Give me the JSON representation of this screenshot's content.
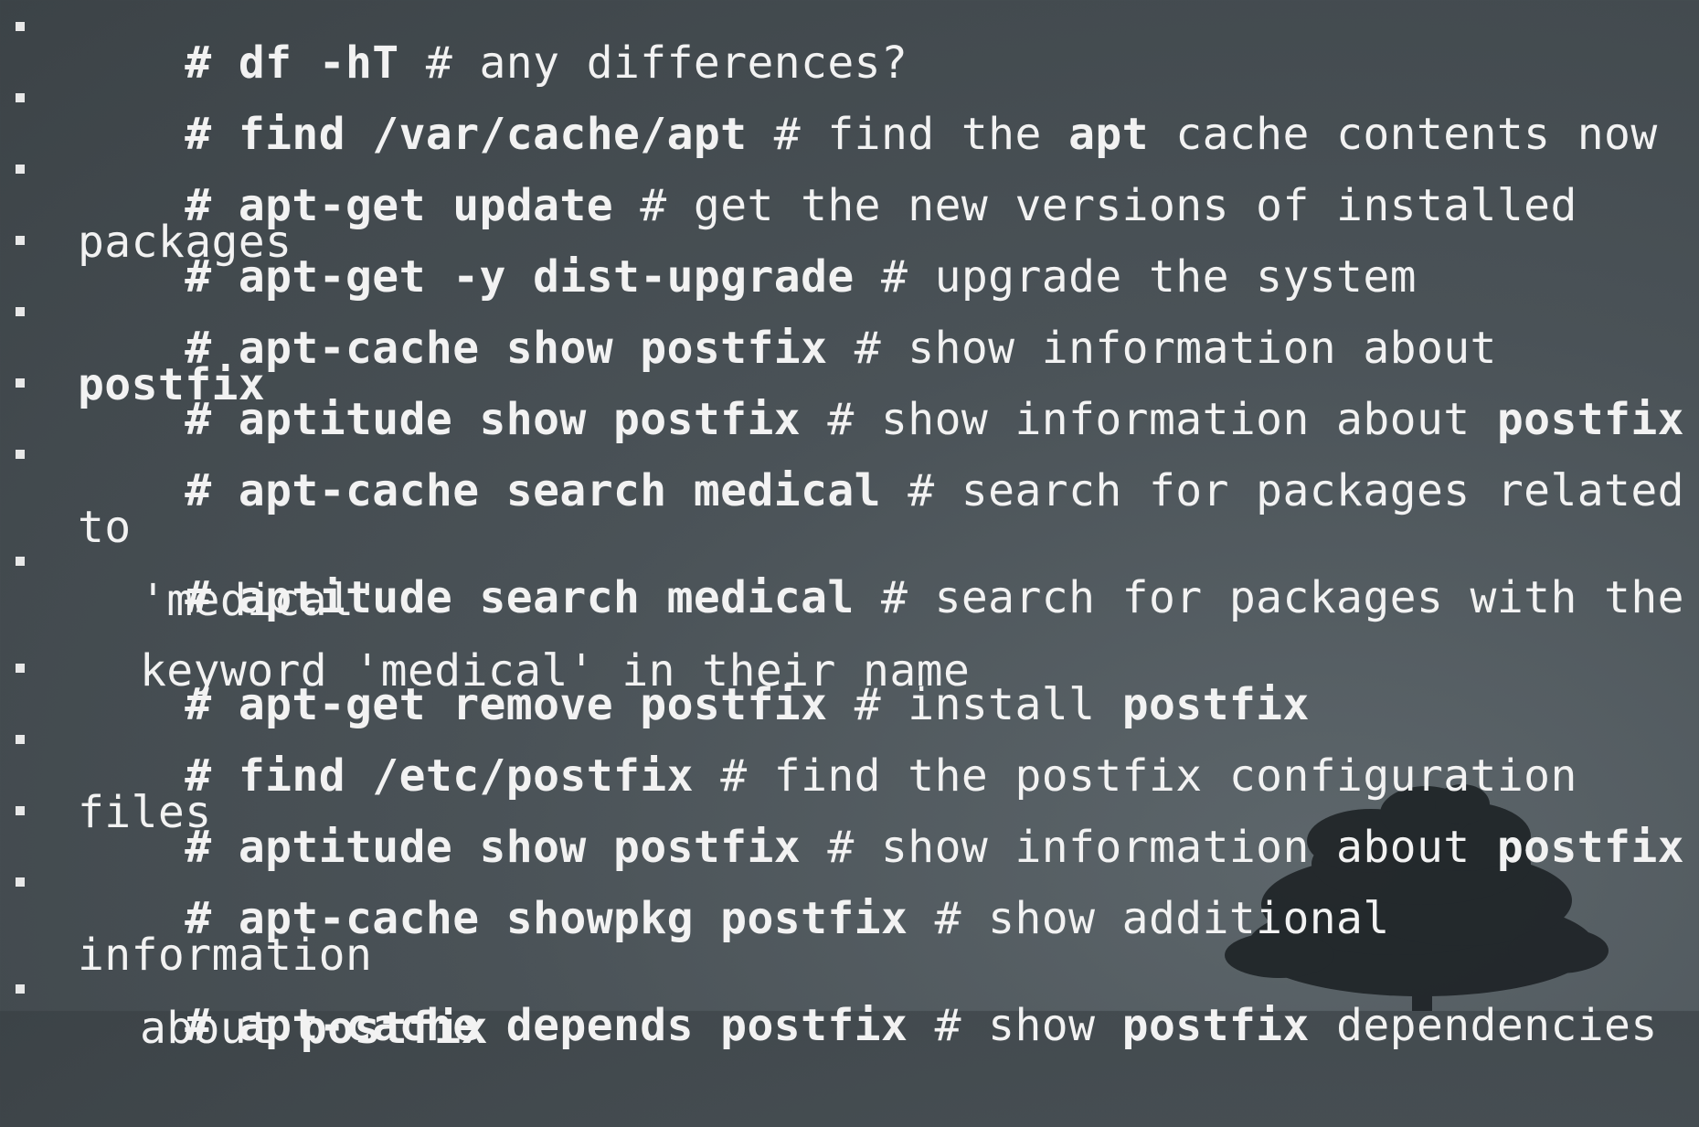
{
  "slide": {
    "items": [
      {
        "hash": "# ",
        "cmd": "df -hT",
        "comment": " # any differences?"
      },
      {
        "hash": "# ",
        "cmd": "find /var/cache/apt",
        "comment": " # find the ",
        "b1": "apt",
        "comment2": " cache contents now"
      },
      {
        "hash": "# ",
        "cmd": "apt-get update",
        "comment": " # get the new versions of installed packages"
      },
      {
        "hash": "# ",
        "cmd": "apt-get -y dist-upgrade",
        "comment": " # upgrade the system"
      },
      {
        "hash": "# ",
        "cmd": "apt-cache show postfix",
        "comment": " # show information about ",
        "b1": "postfix"
      },
      {
        "hash": "# ",
        "cmd": "aptitude show postfix",
        "comment": " # show information about ",
        "b1": "postfix"
      },
      {
        "hash": "# ",
        "cmd": "apt-cache search medical",
        "comment": " # search for packages related to",
        "cont": "'medical'"
      },
      {
        "hash": "# ",
        "cmd": "aptitude search medical",
        "comment": " # search for packages with the",
        "cont": "keyword 'medical' in their name"
      },
      {
        "hash": "# ",
        "cmd": "apt-get remove postfix",
        "comment": " # install ",
        "b1": "postfix"
      },
      {
        "hash": "# ",
        "cmd": "find /etc/postfix",
        "comment": " # find the postfix configuration files"
      },
      {
        "hash": "# ",
        "cmd": "aptitude show postfix",
        "comment": " # show information about ",
        "b1": "postfix"
      },
      {
        "hash": "# ",
        "cmd": "apt-cache showpkg postfix",
        "comment": " # show additional information",
        "cont": "about ",
        "cont_b": "postfix"
      },
      {
        "hash": "# ",
        "cmd": "apt-cache depends postfix",
        "comment": " # show ",
        "b1": "postfix",
        "comment2": " dependencies"
      }
    ]
  }
}
